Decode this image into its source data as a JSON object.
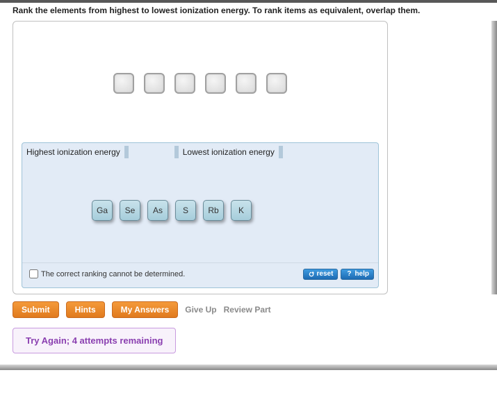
{
  "instruction": "Rank the elements from highest to lowest ionization energy. To rank items as equivalent, overlap them.",
  "rank": {
    "high_label": "Highest ionization energy",
    "low_label": "Lowest ionization energy",
    "elements": [
      "Ga",
      "Se",
      "As",
      "S",
      "Rb",
      "K"
    ]
  },
  "footer": {
    "cannot_determine": "The correct ranking cannot be determined.",
    "reset": "reset",
    "help": "help"
  },
  "actions": {
    "submit": "Submit",
    "hints": "Hints",
    "my_answers": "My Answers",
    "give_up": "Give Up",
    "review_part": "Review Part"
  },
  "feedback": "Try Again; 4 attempts remaining"
}
